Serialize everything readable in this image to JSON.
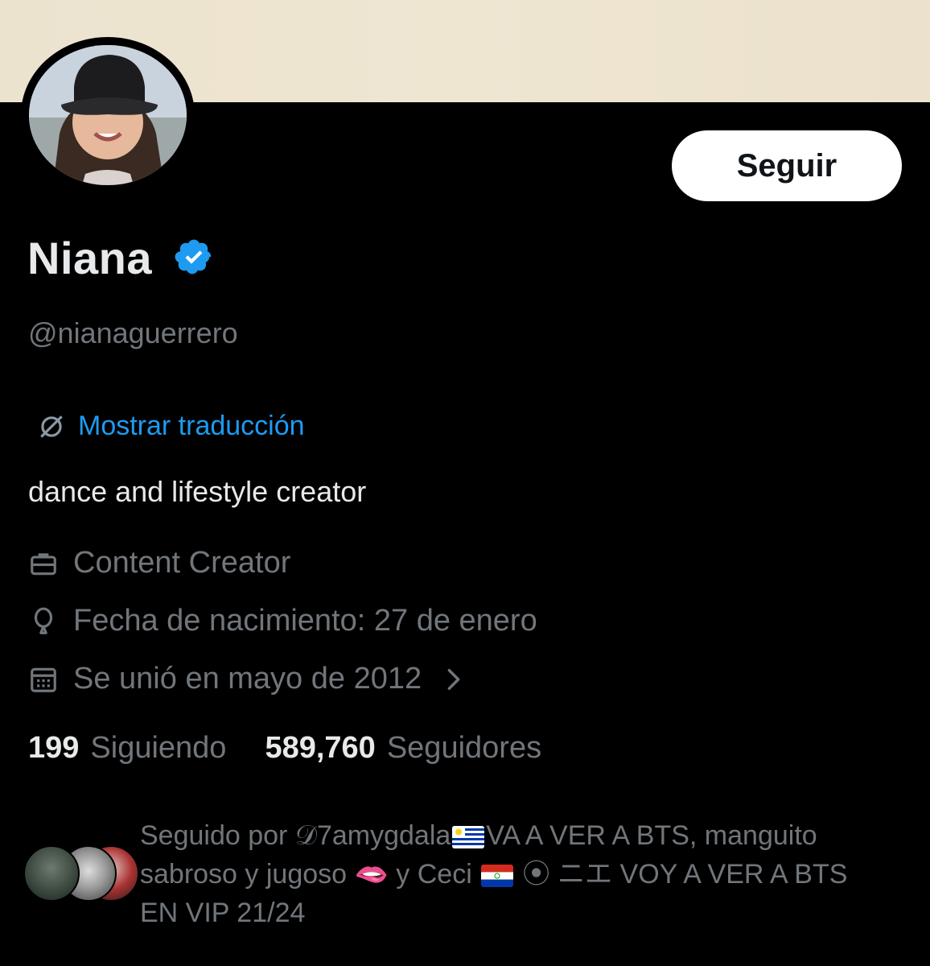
{
  "profile": {
    "name": "Niana",
    "handle": "@nianaguerrero",
    "follow_label": "Seguir",
    "translate_label": "Mostrar traducción",
    "bio": "dance and lifestyle creator",
    "job": "Content Creator",
    "birthday": "Fecha de nacimiento: 27 de enero",
    "joined": "Se unió en mayo de 2012",
    "following_count": "199",
    "following_label": "Siguiendo",
    "followers_count": "589,760",
    "followers_label": "Seguidores"
  },
  "followed_by": {
    "prefix": "Seguido por ",
    "user1": "𝒟7amygdala",
    "user1_rest": "VA A VER A BTS, manguito sabroso y jugoso ",
    "lips": "🫦",
    "conj": " y Ceci ",
    "user2_rest": " ⦿ ニエ VOY A VER A BTS EN VIP 21/24"
  },
  "colors": {
    "background": "#000000",
    "accent": "#1d9bf0",
    "secondary_text": "#71767b",
    "primary_text": "#e7e9ea",
    "banner": "#ece3cf"
  },
  "icons": [
    "verified-badge-icon",
    "translate-icon",
    "briefcase-icon",
    "balloon-icon",
    "calendar-icon",
    "chevron-right-icon",
    "uruguay-flag-icon",
    "paraguay-flag-icon"
  ]
}
